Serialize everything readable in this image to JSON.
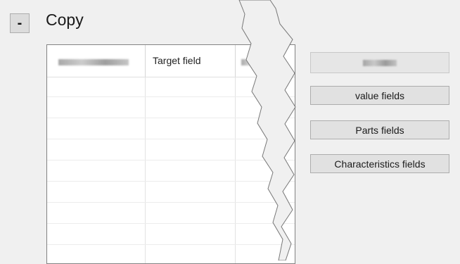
{
  "section": {
    "toggle_symbol": "-",
    "title": "Copy"
  },
  "grid": {
    "columns": [
      {
        "header": "",
        "blurred": true
      },
      {
        "header": "Target field",
        "blurred": false
      },
      {
        "header": "",
        "blurred": true
      }
    ],
    "row_count": 8
  },
  "buttons": {
    "top_blurred_label": "",
    "value_fields": "value fields",
    "parts_fields": "Parts fields",
    "characteristics_fields": "Characteristics fields"
  }
}
